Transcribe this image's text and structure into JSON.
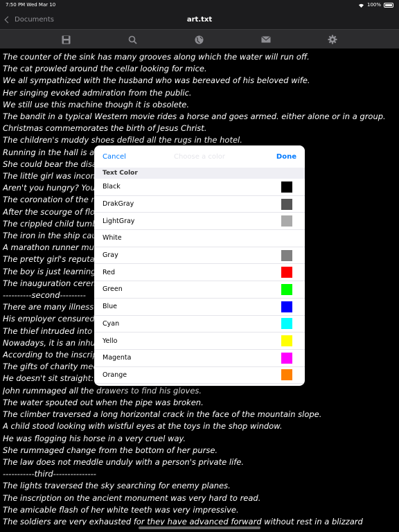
{
  "status": {
    "time_date": "7:50 PM   Wed Mar 10",
    "battery": "100%"
  },
  "nav": {
    "back_label": "Documents",
    "title": "art.txt"
  },
  "toolbar": {
    "icons": [
      "save-icon",
      "search-icon",
      "globe-icon",
      "mail-icon",
      "gear-icon"
    ]
  },
  "document_lines": [
    "The counter of the sink has many grooves along which the water will run off.",
    "The cat prowled around the cellar looking for mice.",
    "We all sympathized with the husband who was bereaved of his beloved wife.",
    "Her singing evoked admiration from the public.",
    "We still use this machine though it is obsolete.",
    "The bandit in a typical Western movie rides a horse and goes armed. either alone or in a group.",
    "Christmas commemorates the birth of Jesus Christ.",
    "The children's muddy shoes defiled all the rugs in the hotel.",
    "Running in the hall is a c",
    "She could bear the disa",
    "The little girl was incons",
    "Aren't you hungry? You",
    "The coronation of the n",
    "After the scourge of floo",
    "The crippled child tumb",
    "The iron in the ship caus                                                                    s.",
    "A marathon runner mus",
    "The pretty girl's reputat",
    "The boy is just learning",
    "The inauguration cerem",
    "----------second---------",
    "There are many illnesses",
    "His employer censured",
    "The thief intruded into t",
    "Nowadays, it is an inhur                                                                  ilors.",
    "According to the inscrip                                                                  19.",
    "The gifts of charity med",
    "He doesn't sit straight: f",
    "John rummaged all the drawers to find his gloves.",
    "The water spouted out when the pipe was broken.",
    "The climber traversed a long horizontal crack in the face of the mountain slope.",
    "A child stood looking with wistful eyes at the toys in the shop window.",
    "He was flogging his horse in a very cruel way.",
    "She rummaged change from the bottom of her purse.",
    "The law does not meddle unduly with a person's private life.",
    "-----------third---------------",
    "The lights traversed the sky searching for enemy planes.",
    "The inscription on the ancient monument was very hard to read.",
    "The amicable flash of her white teeth was very impressive.",
    "The soldiers are very exhausted for they have advanced forward without rest in a blizzard"
  ],
  "popover": {
    "cancel_label": "Cancel",
    "title": "Choose a color",
    "done_label": "Done",
    "section_title": "Text Color",
    "colors": [
      {
        "name": "Black",
        "hex": "#000000"
      },
      {
        "name": "DrakGray",
        "hex": "#555555"
      },
      {
        "name": "LightGray",
        "hex": "#aaaaaa"
      },
      {
        "name": "White",
        "hex": "#ffffff"
      },
      {
        "name": "Gray",
        "hex": "#808080"
      },
      {
        "name": "Red",
        "hex": "#ff0000"
      },
      {
        "name": "Green",
        "hex": "#00ff00"
      },
      {
        "name": "Blue",
        "hex": "#0000ff"
      },
      {
        "name": "Cyan",
        "hex": "#00ffff"
      },
      {
        "name": "Yello",
        "hex": "#ffff00"
      },
      {
        "name": "Magenta",
        "hex": "#ff00ff"
      },
      {
        "name": "Orange",
        "hex": "#ff8000"
      }
    ]
  }
}
